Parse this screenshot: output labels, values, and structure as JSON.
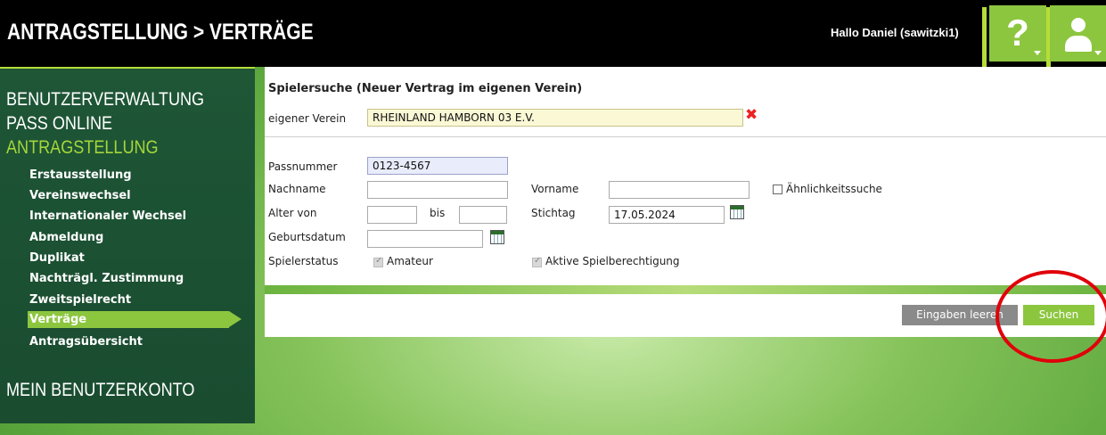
{
  "header": {
    "title": "ANTRAGSTELLUNG > VERTRÄGE",
    "greeting": "Hallo Daniel (sawitzki1)",
    "help_symbol": "?",
    "icons": [
      "help-icon",
      "user-icon",
      "chevron-down-icon"
    ]
  },
  "sidebar": {
    "sections": [
      "BENUTZERVERWALTUNG",
      "PASS ONLINE",
      "ANTRAGSTELLUNG",
      "MEIN BENUTZERKONTO"
    ],
    "items": [
      "Erstausstellung",
      "Vereinswechsel",
      "Internationaler Wechsel",
      "Abmeldung",
      "Duplikat",
      "Nachträgl. Zustimmung",
      "Zweitspielrecht",
      "Verträge",
      "Antragsübersicht"
    ],
    "active_item": "Verträge",
    "accent_color": "#8cc63f"
  },
  "form": {
    "title": "Spielersuche (Neuer Vertrag im eigenen Verein)",
    "verein_label": "eigener Verein",
    "verein_value": "RHEINLAND HAMBORN 03 E.V.",
    "passnummer_label": "Passnummer",
    "passnummer_value": "0123-4567",
    "nachname_label": "Nachname",
    "nachname_value": "",
    "vorname_label": "Vorname",
    "vorname_value": "",
    "aehnlichkeit_label": "Ähnlichkeitssuche",
    "alter_label": "Alter von",
    "alter_von_value": "",
    "bis_label": "bis",
    "alter_bis_value": "",
    "stichtag_label": "Stichtag",
    "stichtag_value": "17.05.2024",
    "geburtsdatum_label": "Geburtsdatum",
    "geburtsdatum_value": "",
    "spielerstatus_label": "Spielerstatus",
    "amateur_label": "Amateur",
    "aktive_label": "Aktive Spielberechtigung"
  },
  "actions": {
    "clear_label": "Eingaben leeren",
    "search_label": "Suchen"
  },
  "colors": {
    "header_bg": "#000000",
    "sidebar_bg": "#1e5636",
    "accent": "#8cc63f",
    "annotation": "#e0000a"
  }
}
